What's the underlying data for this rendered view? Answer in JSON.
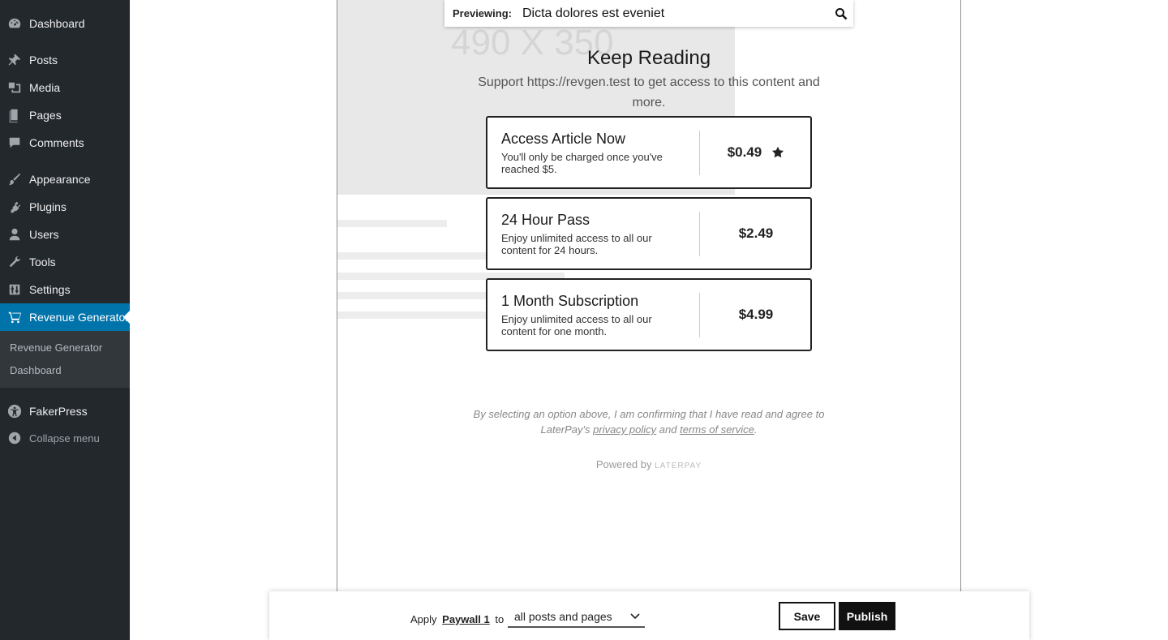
{
  "sidebar": {
    "items": [
      {
        "label": "Dashboard",
        "icon": "dashboard-icon"
      },
      {
        "label": "Posts",
        "icon": "pin-icon"
      },
      {
        "label": "Media",
        "icon": "media-icon"
      },
      {
        "label": "Pages",
        "icon": "pages-icon"
      },
      {
        "label": "Comments",
        "icon": "comment-icon"
      },
      {
        "label": "Appearance",
        "icon": "brush-icon"
      },
      {
        "label": "Plugins",
        "icon": "plugin-icon"
      },
      {
        "label": "Users",
        "icon": "user-icon"
      },
      {
        "label": "Tools",
        "icon": "wrench-icon"
      },
      {
        "label": "Settings",
        "icon": "settings-icon"
      },
      {
        "label": "Revenue Generator",
        "icon": "cart-icon"
      }
    ],
    "submenu": {
      "line1": "Revenue Generator",
      "line2": "Dashboard"
    },
    "fakerpress": {
      "label": "FakerPress",
      "icon": "accessibility-icon"
    },
    "collapse": {
      "label": "Collapse menu",
      "icon": "collapse-arrow-icon"
    },
    "colors": {
      "bg": "#23282d",
      "active": "#0073aa"
    }
  },
  "preview": {
    "label": "Previewing:",
    "value": "Dicta dolores est eveniet"
  },
  "paywall": {
    "title": "Keep Reading",
    "subtitle": "Support https://revgen.test to get access to this content and more.",
    "options": [
      {
        "title": "Access Article Now",
        "description": "You'll only be charged once you've reached $5.",
        "price": "$0.49",
        "starred": true
      },
      {
        "title": "24 Hour Pass",
        "description": "Enjoy unlimited access to all our content for 24 hours.",
        "price": "$2.49",
        "starred": false
      },
      {
        "title": "1 Month Subscription",
        "description": "Enjoy unlimited access to all our content for one month.",
        "price": "$4.99",
        "starred": false
      }
    ],
    "legal": {
      "prefix": "By selecting an option above, I am confirming that I have read and agree to LaterPay's",
      "privacy": "privacy policy",
      "and": "and",
      "terms": "terms of service",
      "suffix": "."
    },
    "powered_by": "Powered by",
    "brand": "LATERPAY"
  },
  "background": {
    "placeholder": "490 X 350"
  },
  "bottom_bar": {
    "apply": "Apply",
    "paywall_name": "Paywall 1",
    "to": "to",
    "scope": "all posts and pages",
    "save": "Save",
    "publish": "Publish"
  }
}
